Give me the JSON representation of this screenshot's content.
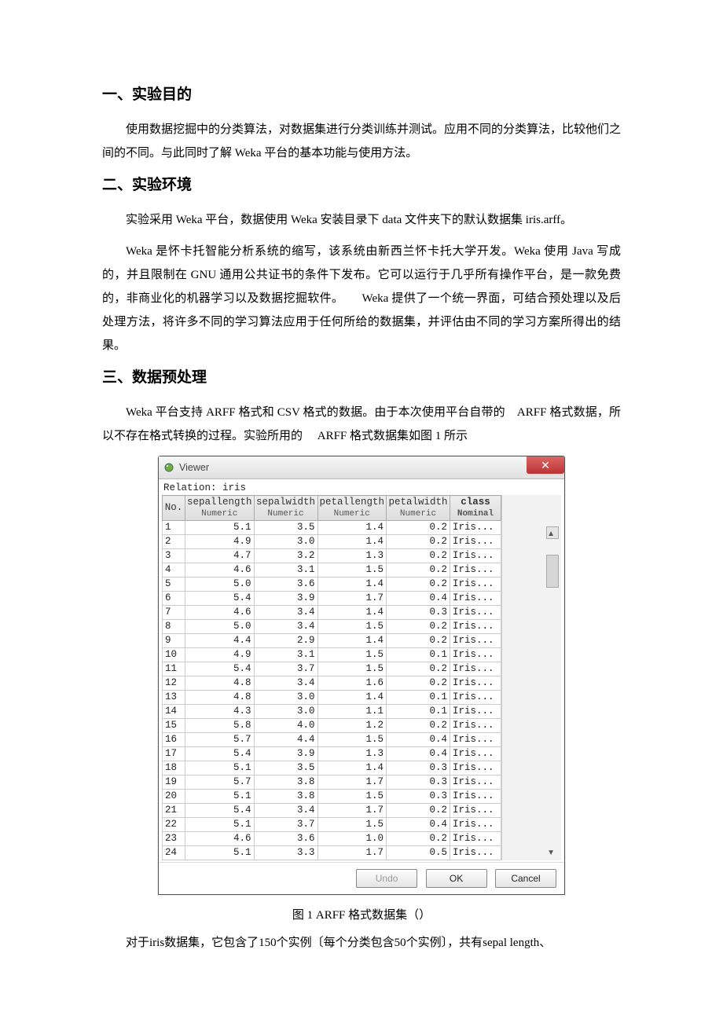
{
  "sections": {
    "s1_title": "一、实验目的",
    "s1_para": "使用数据挖掘中的分类算法，对数据集进行分类训练并测试。应用不同的分类算法，比较他们之间的不同。与此同时了解 Weka 平台的基本功能与使用方法。",
    "s2_title": "二、实验环境",
    "s2_para1": "实验采用 Weka 平台，数据使用 Weka 安装目录下 data 文件夹下的默认数据集 iris.arff。",
    "s2_para2": "Weka 是怀卡托智能分析系统的缩写，该系统由新西兰怀卡托大学开发。Weka 使用 Java 写成的，并且限制在 GNU 通用公共证书的条件下发布。它可以运行于几乎所有操作平台，是一款免费的，非商业化的机器学习以及数据挖掘软件。　　Weka 提供了一个统一界面，可结合预处理以及后处理方法，将许多不同的学习算法应用于任何所给的数据集，并评估由不同的学习方案所得出的结果。",
    "s3_title": "三、数据预处理",
    "s3_para1": "Weka 平台支持 ARFF 格式和 CSV 格式的数据。由于本次使用平台自带的　ARFF 格式数据，所以不存在格式转换的过程。实验所用的　 ARFF 格式数据集如图 1 所示"
  },
  "viewer": {
    "title": "Viewer",
    "relation": "Relation: iris",
    "close": "✕",
    "columns": {
      "no": "No.",
      "sepallength": "sepallength",
      "sepalwidth": "sepalwidth",
      "petallength": "petallength",
      "petalwidth": "petalwidth",
      "class": "class",
      "numeric": "Numeric",
      "nominal": "Nominal"
    },
    "rows": [
      {
        "no": "1",
        "sl": "5.1",
        "sw": "3.5",
        "pl": "1.4",
        "pw": "0.2",
        "cl": "Iris..."
      },
      {
        "no": "2",
        "sl": "4.9",
        "sw": "3.0",
        "pl": "1.4",
        "pw": "0.2",
        "cl": "Iris..."
      },
      {
        "no": "3",
        "sl": "4.7",
        "sw": "3.2",
        "pl": "1.3",
        "pw": "0.2",
        "cl": "Iris..."
      },
      {
        "no": "4",
        "sl": "4.6",
        "sw": "3.1",
        "pl": "1.5",
        "pw": "0.2",
        "cl": "Iris..."
      },
      {
        "no": "5",
        "sl": "5.0",
        "sw": "3.6",
        "pl": "1.4",
        "pw": "0.2",
        "cl": "Iris..."
      },
      {
        "no": "6",
        "sl": "5.4",
        "sw": "3.9",
        "pl": "1.7",
        "pw": "0.4",
        "cl": "Iris..."
      },
      {
        "no": "7",
        "sl": "4.6",
        "sw": "3.4",
        "pl": "1.4",
        "pw": "0.3",
        "cl": "Iris..."
      },
      {
        "no": "8",
        "sl": "5.0",
        "sw": "3.4",
        "pl": "1.5",
        "pw": "0.2",
        "cl": "Iris..."
      },
      {
        "no": "9",
        "sl": "4.4",
        "sw": "2.9",
        "pl": "1.4",
        "pw": "0.2",
        "cl": "Iris..."
      },
      {
        "no": "10",
        "sl": "4.9",
        "sw": "3.1",
        "pl": "1.5",
        "pw": "0.1",
        "cl": "Iris..."
      },
      {
        "no": "11",
        "sl": "5.4",
        "sw": "3.7",
        "pl": "1.5",
        "pw": "0.2",
        "cl": "Iris..."
      },
      {
        "no": "12",
        "sl": "4.8",
        "sw": "3.4",
        "pl": "1.6",
        "pw": "0.2",
        "cl": "Iris..."
      },
      {
        "no": "13",
        "sl": "4.8",
        "sw": "3.0",
        "pl": "1.4",
        "pw": "0.1",
        "cl": "Iris..."
      },
      {
        "no": "14",
        "sl": "4.3",
        "sw": "3.0",
        "pl": "1.1",
        "pw": "0.1",
        "cl": "Iris..."
      },
      {
        "no": "15",
        "sl": "5.8",
        "sw": "4.0",
        "pl": "1.2",
        "pw": "0.2",
        "cl": "Iris..."
      },
      {
        "no": "16",
        "sl": "5.7",
        "sw": "4.4",
        "pl": "1.5",
        "pw": "0.4",
        "cl": "Iris..."
      },
      {
        "no": "17",
        "sl": "5.4",
        "sw": "3.9",
        "pl": "1.3",
        "pw": "0.4",
        "cl": "Iris..."
      },
      {
        "no": "18",
        "sl": "5.1",
        "sw": "3.5",
        "pl": "1.4",
        "pw": "0.3",
        "cl": "Iris..."
      },
      {
        "no": "19",
        "sl": "5.7",
        "sw": "3.8",
        "pl": "1.7",
        "pw": "0.3",
        "cl": "Iris..."
      },
      {
        "no": "20",
        "sl": "5.1",
        "sw": "3.8",
        "pl": "1.5",
        "pw": "0.3",
        "cl": "Iris..."
      },
      {
        "no": "21",
        "sl": "5.4",
        "sw": "3.4",
        "pl": "1.7",
        "pw": "0.2",
        "cl": "Iris..."
      },
      {
        "no": "22",
        "sl": "5.1",
        "sw": "3.7",
        "pl": "1.5",
        "pw": "0.4",
        "cl": "Iris..."
      },
      {
        "no": "23",
        "sl": "4.6",
        "sw": "3.6",
        "pl": "1.0",
        "pw": "0.2",
        "cl": "Iris..."
      },
      {
        "no": "24",
        "sl": "5.1",
        "sw": "3.3",
        "pl": "1.7",
        "pw": "0.5",
        "cl": "Iris..."
      }
    ],
    "buttons": {
      "undo": "Undo",
      "ok": "OK",
      "cancel": "Cancel"
    }
  },
  "caption": "图 1 ARFF 格式数据集（）",
  "last_para": "对于iris数据集，它包含了150个实例〔每个分类包含50个实例〕，共有sepal length、"
}
